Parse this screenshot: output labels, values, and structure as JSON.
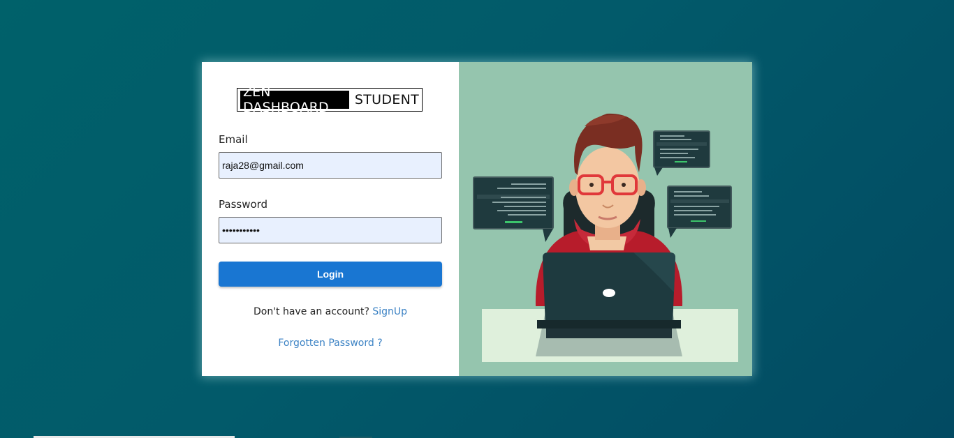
{
  "logo": {
    "part1": "ZEN DASHBOARD",
    "part2": "STUDENT"
  },
  "form": {
    "email_label": "Email",
    "email_value": "raja28@gmail.com",
    "password_label": "Password",
    "password_value": "•••••••••••",
    "login_label": "Login"
  },
  "signup": {
    "prompt": "Don't have an account?",
    "link": "SignUp"
  },
  "forgot": {
    "link": "Forgotten Password ?"
  },
  "colors": {
    "background": "#025a6a",
    "primary_button": "#1976d2",
    "link": "#3b82c4",
    "illustration_bg": "#95c5ae",
    "input_bg": "#e8f0fe"
  },
  "illustration": {
    "icon": "developer-with-laptop-illustration"
  }
}
